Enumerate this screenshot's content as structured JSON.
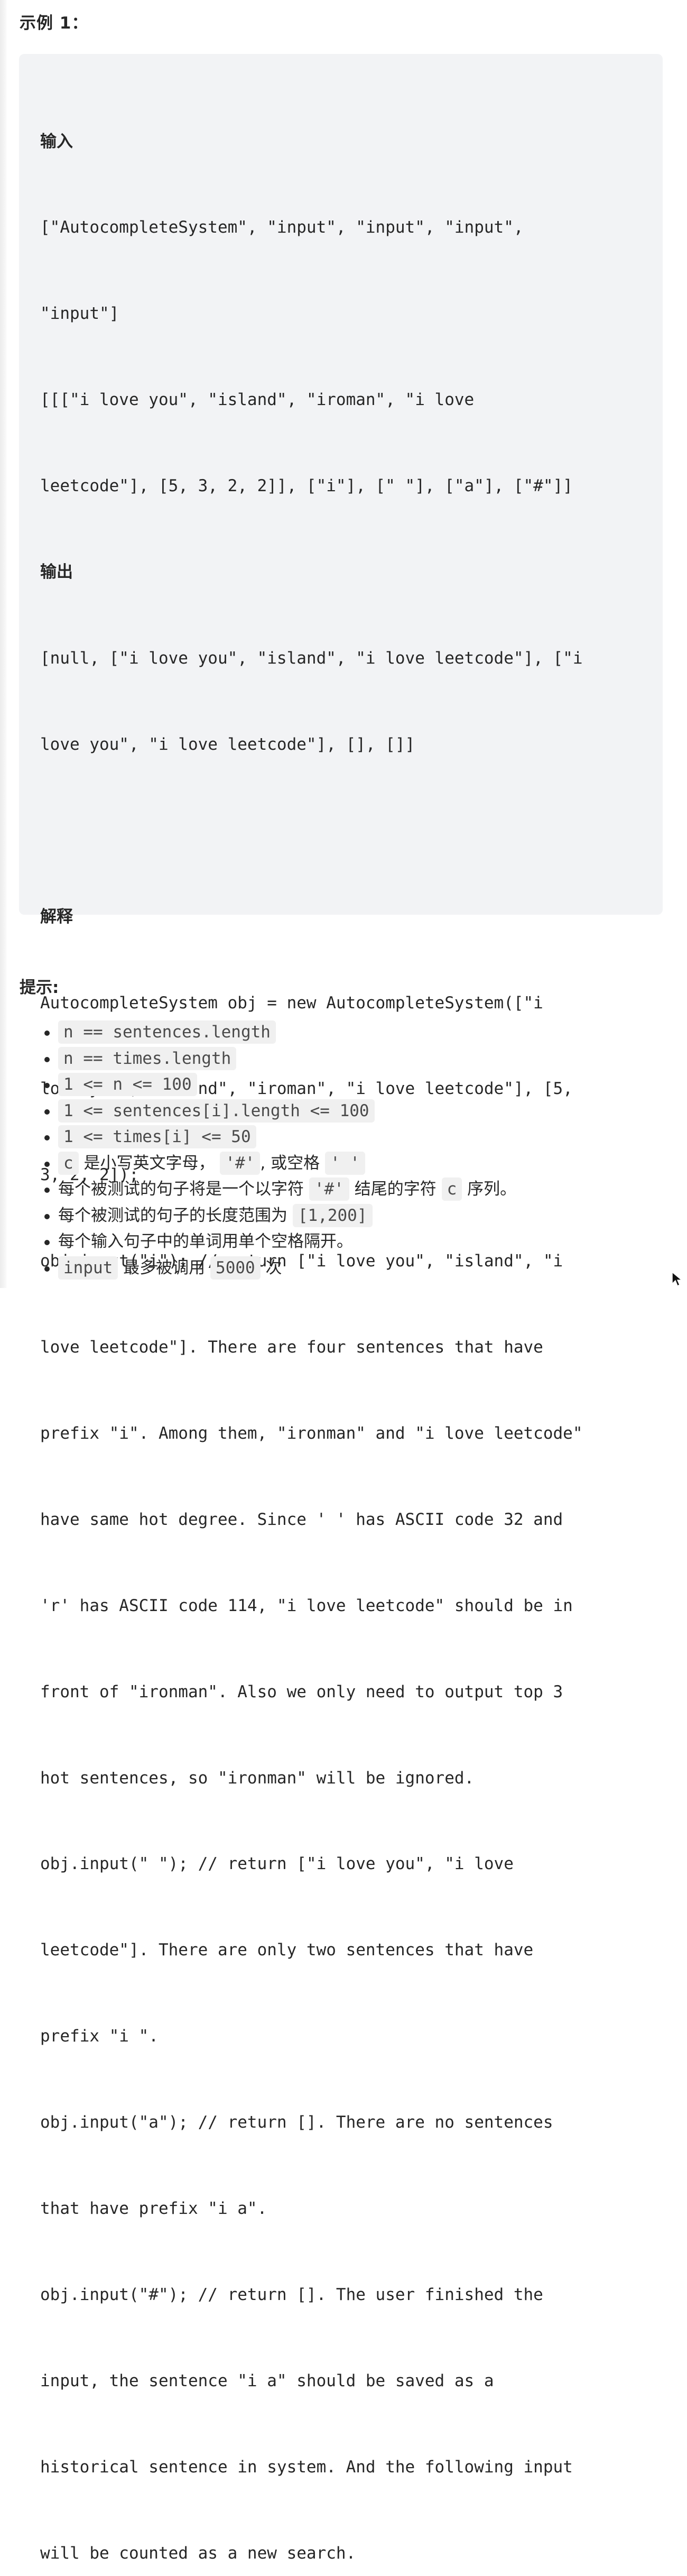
{
  "example": {
    "title": "示例 1：",
    "input_label": "输入",
    "input_lines": [
      "[\"AutocompleteSystem\", \"input\", \"input\", \"input\",",
      "\"input\"]",
      "[[[\"i love you\", \"island\", \"iroman\", \"i love",
      "leetcode\"], [5, 3, 2, 2]], [\"i\"], [\" \"], [\"a\"], [\"#\"]]"
    ],
    "output_label": "输出",
    "output_lines": [
      "[null, [\"i love you\", \"island\", \"i love leetcode\"], [\"i",
      "love you\", \"i love leetcode\"], [], []]"
    ],
    "explain_label": "解释",
    "explain_lines": [
      "AutocompleteSystem obj = new AutocompleteSystem([\"i",
      "love you\", \"island\", \"iroman\", \"i love leetcode\"], [5,",
      "3, 2, 2]);",
      "obj.input(\"i\"); // return [\"i love you\", \"island\", \"i",
      "love leetcode\"]. There are four sentences that have",
      "prefix \"i\". Among them, \"ironman\" and \"i love leetcode\"",
      "have same hot degree. Since ' ' has ASCII code 32 and",
      "'r' has ASCII code 114, \"i love leetcode\" should be in",
      "front of \"ironman\". Also we only need to output top 3",
      "hot sentences, so \"ironman\" will be ignored.",
      "obj.input(\" \"); // return [\"i love you\", \"i love",
      "leetcode\"]. There are only two sentences that have",
      "prefix \"i \".",
      "obj.input(\"a\"); // return []. There are no sentences",
      "that have prefix \"i a\".",
      "obj.input(\"#\"); // return []. The user finished the",
      "input, the sentence \"i a\" should be saved as a",
      "historical sentence in system. And the following input",
      "will be counted as a new search."
    ]
  },
  "tips": {
    "title": "提示:",
    "items": [
      {
        "code1": "n == sentences.length"
      },
      {
        "code1": "n == times.length"
      },
      {
        "code1": "1 <= n <= 100"
      },
      {
        "code1": "1 <= sentences[i].length <= 100"
      },
      {
        "code1": "1 <= times[i] <= 50"
      },
      {
        "code1": "c",
        "text1": " 是小写英文字母， ",
        "code2": "'#'",
        "text2": ", 或空格 ",
        "code3": "' '"
      },
      {
        "text1": "每个被测试的句子将是一个以字符 ",
        "code1": "'#'",
        "text2": " 结尾的字符 ",
        "code2": "c",
        "text3": " 序列。"
      },
      {
        "text1": "每个被测试的句子的长度范围为 ",
        "code1": "[1,200]"
      },
      {
        "text1": "每个输入句子中的单词用单个空格隔开。"
      },
      {
        "code1": "input",
        "text1": " 最多被调用 ",
        "code2": "5000",
        "text2": " 次"
      }
    ]
  }
}
